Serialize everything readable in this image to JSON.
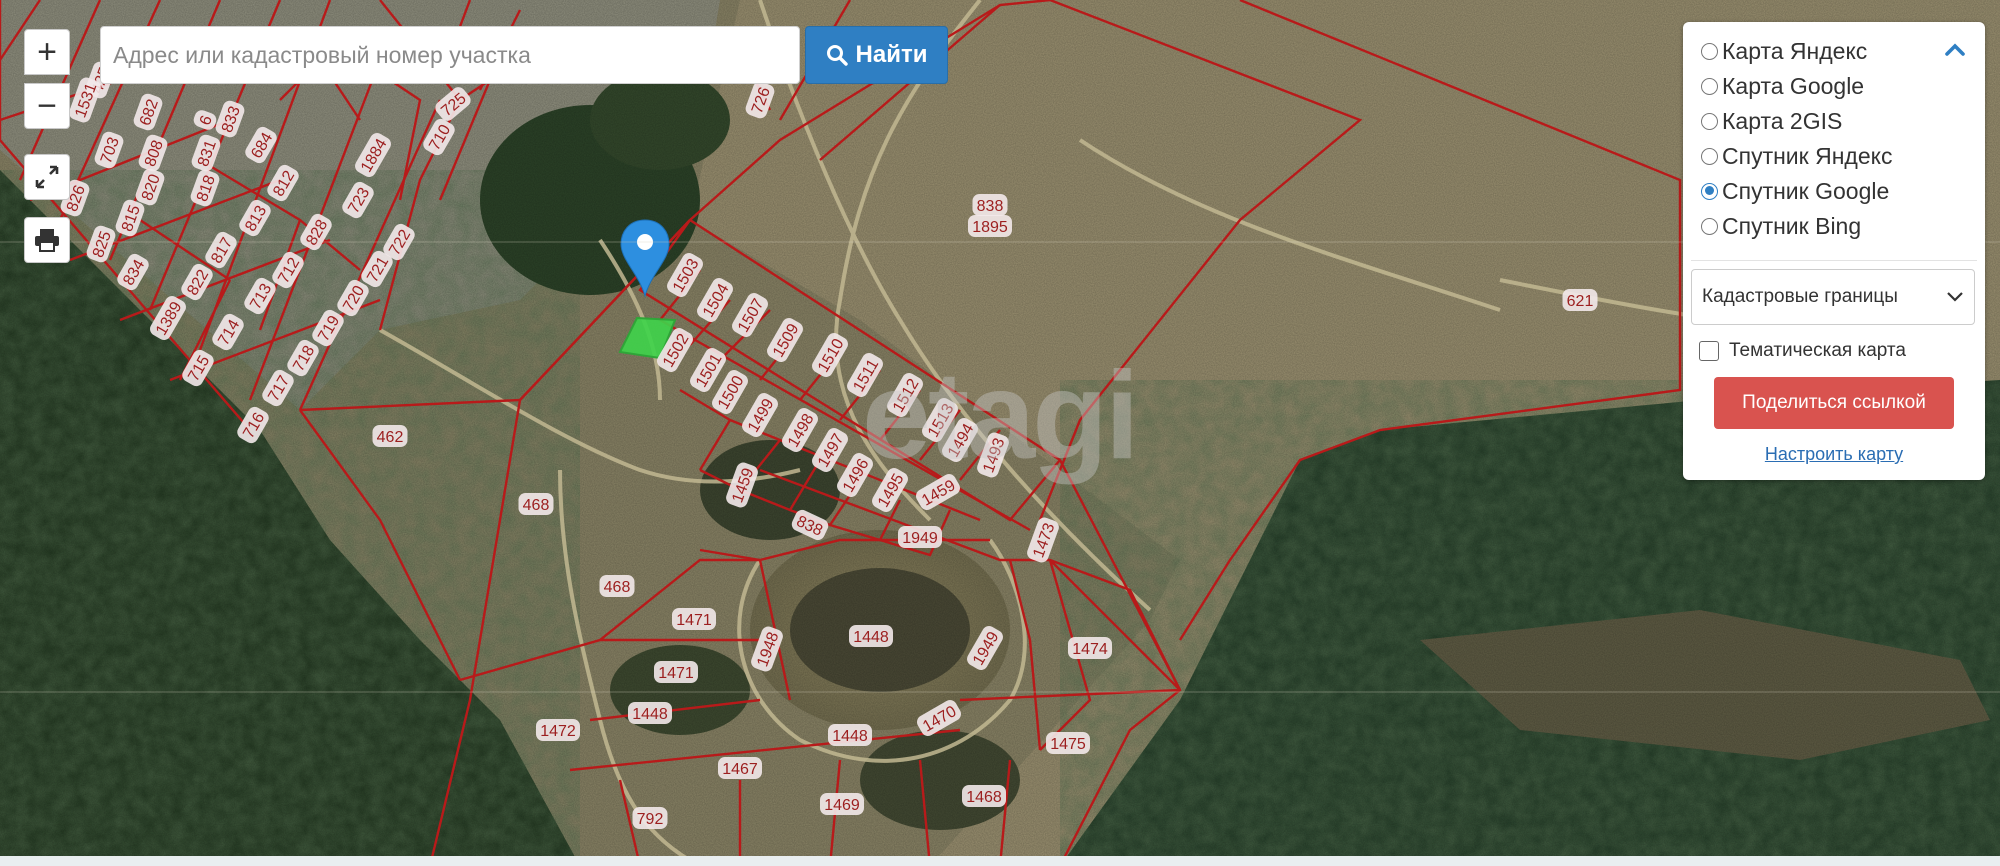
{
  "search": {
    "placeholder": "Адрес или кадастровый номер участка",
    "button_label": "Найти"
  },
  "map_controls": {
    "zoom_in": "+",
    "zoom_out": "−"
  },
  "layers": {
    "options": [
      {
        "label": "Карта Яндекс",
        "selected": false
      },
      {
        "label": "Карта Google",
        "selected": false
      },
      {
        "label": "Карта 2GIS",
        "selected": false
      },
      {
        "label": "Спутник Яндекс",
        "selected": false
      },
      {
        "label": "Спутник Google",
        "selected": true
      },
      {
        "label": "Спутник Bing",
        "selected": false
      }
    ],
    "boundaries_select": "Кадастровые границы",
    "thematic_label": "Тематическая карта",
    "thematic_checked": false,
    "share_label": "Поделиться ссылкой",
    "configure_label": "Настроить карту"
  },
  "watermark": "etagi",
  "colors": {
    "accent": "#2f7fc3",
    "share": "#d9534f",
    "boundary": "#b81a1a",
    "selected_plot": "#3ed44a",
    "label_bg": "#f3e9ea",
    "label_text": "#9c1f1f"
  },
  "parcel_labels": [
    "1504",
    "1507",
    "1509",
    "1510",
    "1511",
    "1512",
    "1513",
    "1494",
    "1493",
    "1503",
    "1502",
    "1501",
    "1500",
    "1499",
    "1498",
    "1497",
    "1496",
    "1495",
    "1459",
    "1459",
    "838",
    "838",
    "1895",
    "621",
    "462",
    "468",
    "468",
    "1472",
    "1471",
    "1471",
    "1448",
    "1448",
    "1448",
    "1948",
    "1949",
    "1949",
    "1470",
    "1473",
    "1474",
    "1475",
    "1468",
    "1467",
    "1469",
    "792",
    "726",
    "725",
    "710",
    "1884",
    "723",
    "722",
    "721",
    "720",
    "719",
    "718",
    "717",
    "716",
    "715",
    "714",
    "713",
    "712",
    "828",
    "813",
    "812",
    "817",
    "822",
    "1389",
    "834",
    "825",
    "815",
    "820",
    "808",
    "818",
    "831",
    "833",
    "684",
    "682",
    "703",
    "826",
    "6",
    "425",
    "1531"
  ]
}
